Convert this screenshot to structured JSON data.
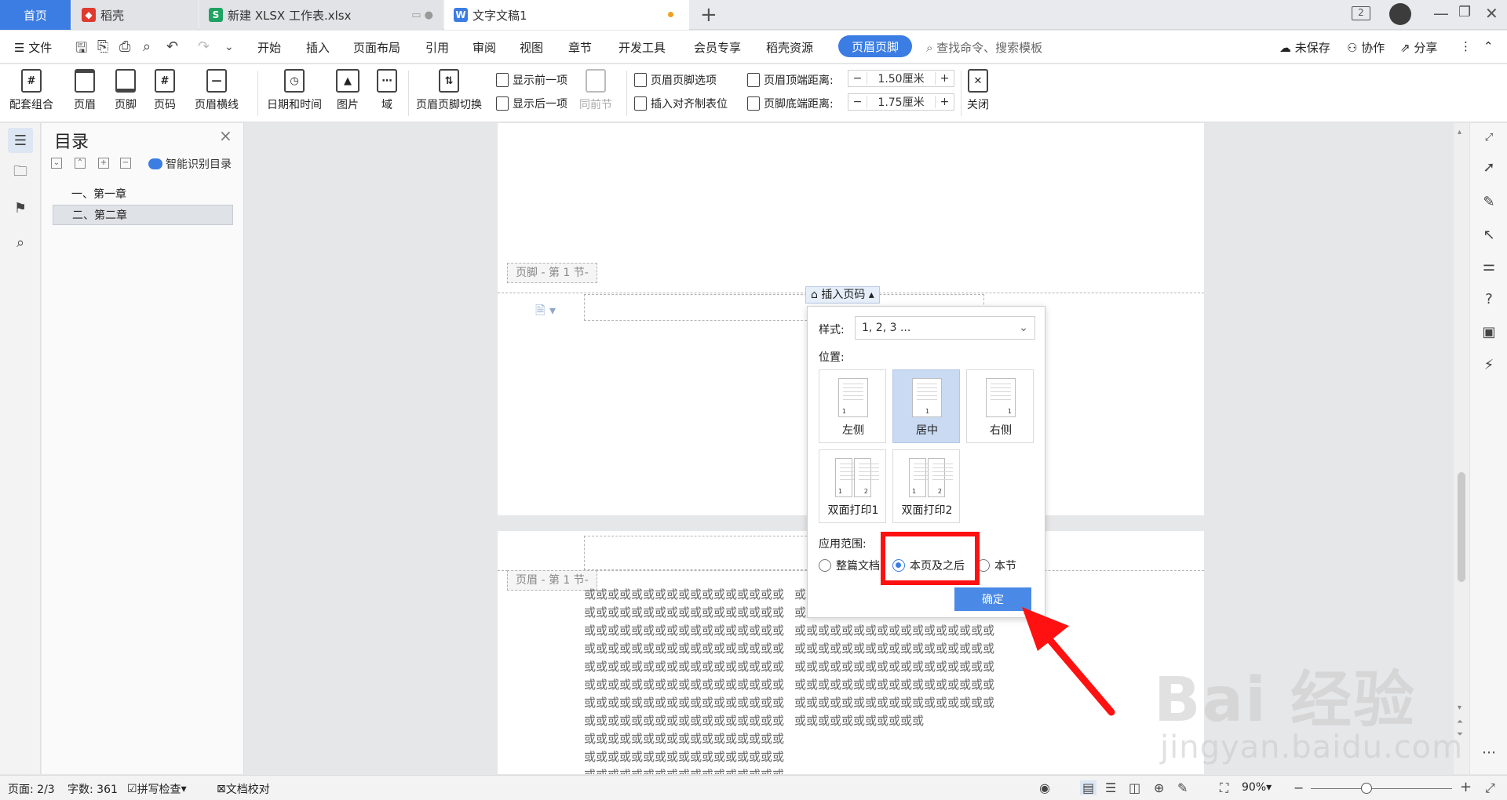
{
  "tabs": {
    "home": "首页",
    "docer": "稻壳",
    "xlsx": "新建 XLSX 工作表.xlsx",
    "doc": "文字文稿1",
    "badge": "2"
  },
  "menu": {
    "file": "文件",
    "items": [
      "开始",
      "插入",
      "页面布局",
      "引用",
      "审阅",
      "视图",
      "章节",
      "开发工具",
      "会员专享",
      "稻壳资源"
    ],
    "active": "页眉页脚",
    "search": "查找命令、搜索模板",
    "unsaved": "未保存",
    "collab": "协作",
    "share": "分享"
  },
  "ribbon": {
    "combo": "配套组合",
    "header": "页眉",
    "footer": "页脚",
    "page_num": "页码",
    "header_line": "页眉横线",
    "date_time": "日期和时间",
    "picture": "图片",
    "field": "域",
    "switch": "页眉页脚切换",
    "show_prev": "显示前一项",
    "show_next": "显示后一项",
    "same_prev": "同前节",
    "hf_options": "页眉页脚选项",
    "insert_align_tab": "插入对齐制表位",
    "top_dist_label": "页眉顶端距离:",
    "top_dist_value": "1.50厘米",
    "bottom_dist_label": "页脚底端距离:",
    "bottom_dist_value": "1.75厘米",
    "close": "关闭"
  },
  "toc": {
    "title": "目录",
    "smart": "智能识别目录",
    "items": [
      "一、第一章",
      "二、第二章"
    ]
  },
  "document": {
    "footer_tag": "页脚 - 第 1 节-",
    "header_tag": "页眉 - 第 1 节-",
    "insert_page_num": "插入页码",
    "body_left": "或或或或或或或或或或或或或或或或或或或或或或或或或或或或或或或或或或或或或或或或或或或或或或或或或或或或或或或或或或或或或或或或或或或或或或或或或或或或或或或或或或或或或或或或或或或或或或或或或或或或或或或或或或或或或或或或或或或或或或或或或或或或或或或或或或或或或或或或或或或或或或或或或或或或或或或或或或或或或或或或或或或或或或或或或或或或或或或或或或或或或或或或或或或或或或或或或或或或或或或或或或或或",
    "body_right": "或或或或或或或或或或或或或或或或或或或或或或或或或或或或或或或或或或或或或或或或或或或或或或或或或或或或或或或或或或或或或或或或或或或或或或或或或或或或或或或或或或或或或或或或或或或或或或或或或或或或或或或或或或或或或或或或或或或或或或或或或或或或或或或或或或"
  },
  "popup": {
    "style_label": "样式:",
    "style_value": "1, 2, 3 ...",
    "position_label": "位置:",
    "positions": [
      "左侧",
      "居中",
      "右侧",
      "双面打印1",
      "双面打印2"
    ],
    "scope_label": "应用范围:",
    "scopes": [
      "整篇文档",
      "本页及之后",
      "本节"
    ],
    "ok": "确定"
  },
  "status": {
    "page": "页面: 2/3",
    "words": "字数: 361",
    "spell": "拼写检查",
    "proof": "文档校对",
    "zoom": "90%"
  },
  "watermark": {
    "big": "Bai 经验",
    "small": "jingyan.baidu.com"
  }
}
